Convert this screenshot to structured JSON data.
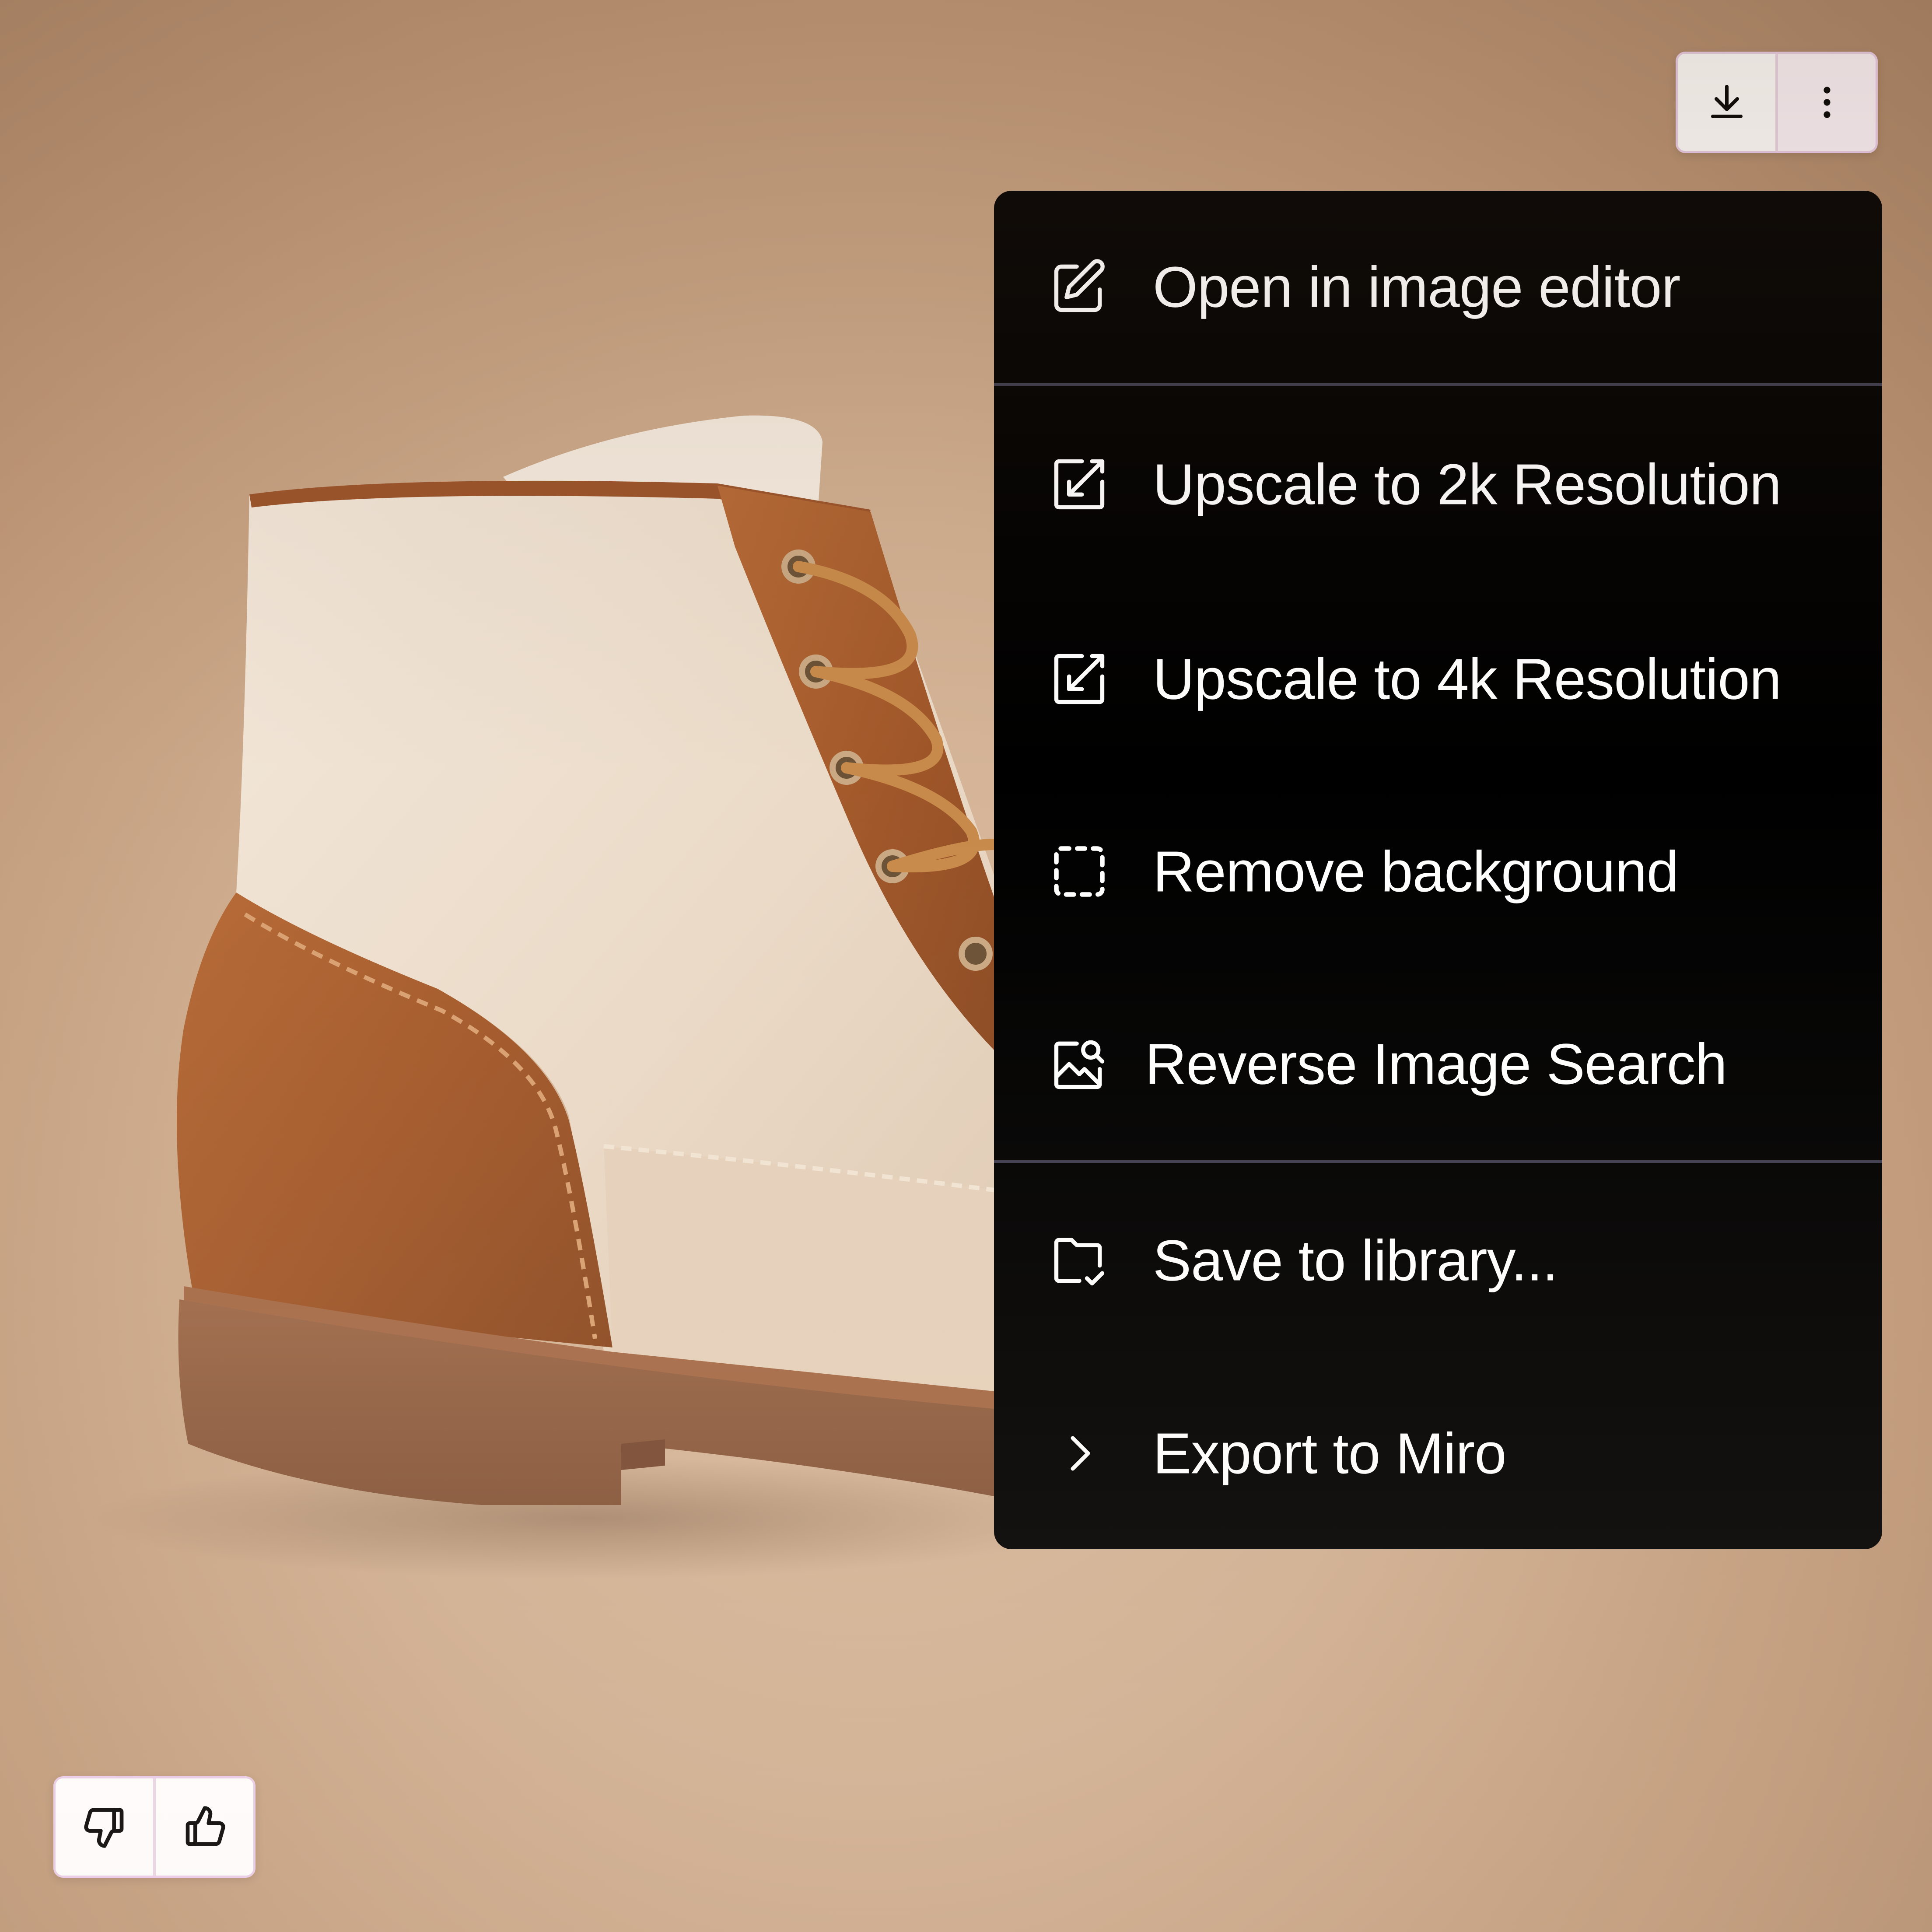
{
  "top_actions": {
    "download": {
      "icon": "download-icon"
    },
    "more": {
      "icon": "more-vertical-icon"
    }
  },
  "menu": {
    "items": [
      {
        "label": "Open in image editor",
        "icon": "edit-pencil-icon"
      },
      {
        "label": "Upscale to 2k Resolution",
        "icon": "upscale-icon"
      },
      {
        "label": "Upscale to 4k Resolution",
        "icon": "upscale-icon"
      },
      {
        "label": "Remove background",
        "icon": "dashed-selection-icon"
      },
      {
        "label": "Reverse Image Search",
        "icon": "image-search-icon"
      },
      {
        "label": "Save to library...",
        "icon": "folder-check-icon"
      },
      {
        "label": "Export to Miro",
        "icon": "chevron-right-icon"
      }
    ]
  },
  "feedback": {
    "dislike": {
      "icon": "thumbs-down-icon"
    },
    "like": {
      "icon": "thumbs-up-icon"
    }
  },
  "colors": {
    "menu_background": "#000000",
    "menu_text": "#ffffff",
    "menu_divider": "#3d3b4f",
    "button_border": "#e9cde8",
    "backdrop": "#d1b092"
  }
}
